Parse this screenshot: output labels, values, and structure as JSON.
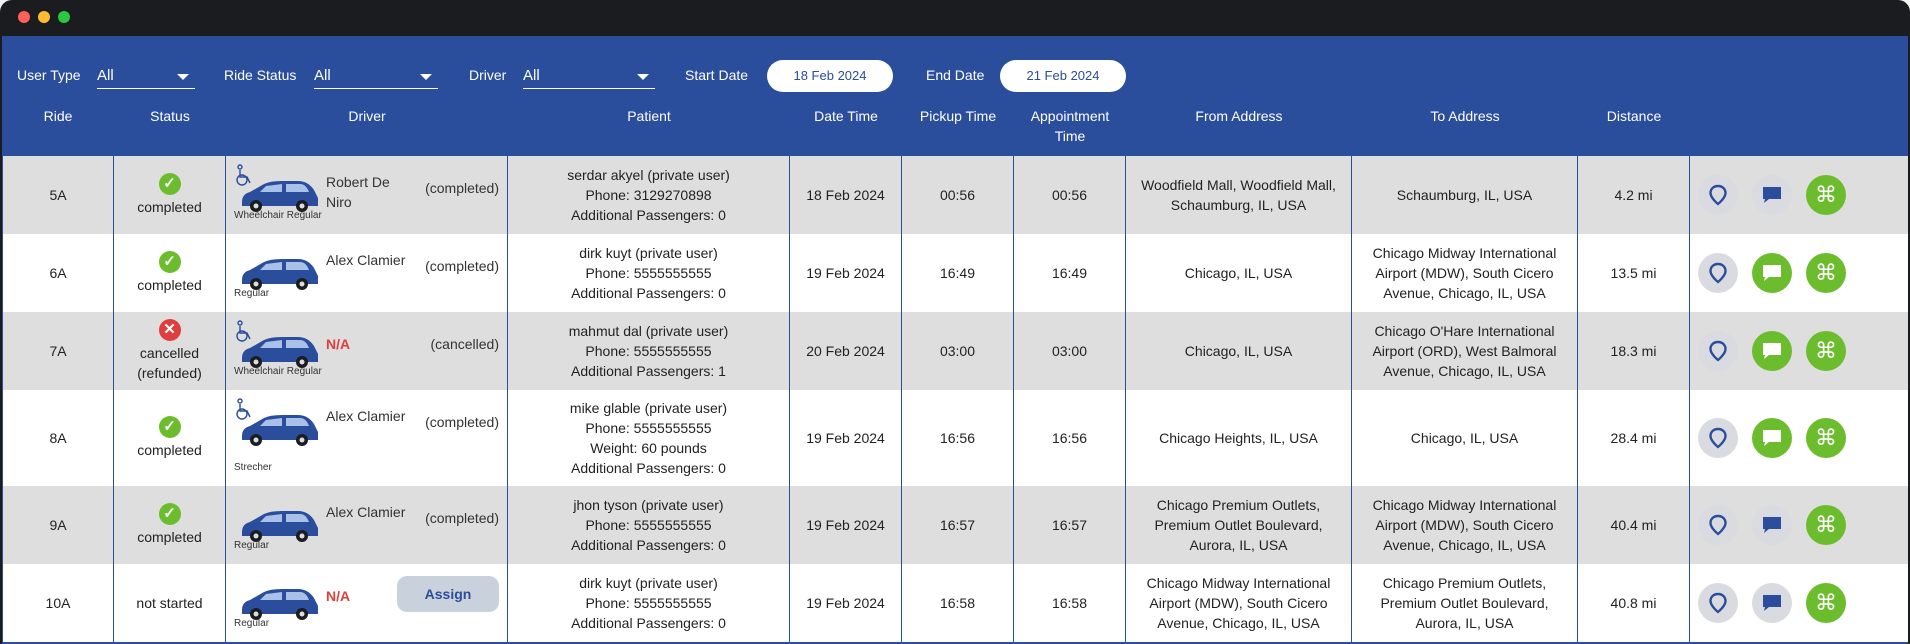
{
  "filters": {
    "user_type_label": "User Type",
    "user_type_value": "All",
    "ride_status_label": "Ride Status",
    "ride_status_value": "All",
    "driver_label": "Driver",
    "driver_value": "All",
    "start_date_label": "Start Date",
    "start_date_value": "18 Feb 2024",
    "end_date_label": "End Date",
    "end_date_value": "21 Feb 2024"
  },
  "columns": {
    "ride": "Ride",
    "status": "Status",
    "driver": "Driver",
    "patient": "Patient",
    "date_time": "Date Time",
    "pickup_time": "Pickup Time",
    "appointment_time_1": "Appointment",
    "appointment_time_2": "Time",
    "from_address": "From Address",
    "to_address": "To Address",
    "distance": "Distance"
  },
  "colors": {
    "header_bg": "#2a4d9c",
    "accent_green": "#6cbd2d",
    "error_red": "#e03e3e"
  },
  "rows": [
    {
      "ride": "5A",
      "status_line1": "completed",
      "status_line2": "",
      "status_icon": "check-icon",
      "vehicle_type": "Wheelchair Regular",
      "driver_name": "Robert De Niro",
      "driver_state": "(completed)",
      "patient_name": "serdar akyel (private user)",
      "patient_phone": "Phone: 3129270898",
      "patient_extra": "",
      "patient_passengers": "Additional Passengers: 0",
      "date_time": "18 Feb 2024",
      "pickup_time": "00:56",
      "appointment_time": "00:56",
      "from_address": "Woodfield Mall, Woodfield Mall, Schaumburg, IL, USA",
      "to_address": "Schaumburg, IL, USA",
      "distance": "4.2 mi"
    },
    {
      "ride": "6A",
      "status_line1": "completed",
      "status_line2": "",
      "status_icon": "check-icon",
      "vehicle_type": "Regular",
      "driver_name": "Alex Clamier",
      "driver_state": "(completed)",
      "patient_name": "dirk kuyt (private user)",
      "patient_phone": "Phone: 5555555555",
      "patient_extra": "",
      "patient_passengers": "Additional Passengers: 0",
      "date_time": "19 Feb 2024",
      "pickup_time": "16:49",
      "appointment_time": "16:49",
      "from_address": "Chicago, IL, USA",
      "to_address": "Chicago Midway International Airport (MDW), South Cicero Avenue, Chicago, IL, USA",
      "distance": "13.5 mi"
    },
    {
      "ride": "7A",
      "status_line1": "cancelled",
      "status_line2": "(refunded)",
      "status_icon": "x-icon",
      "vehicle_type": "Wheelchair Regular",
      "driver_name": "N/A",
      "driver_state": "(cancelled)",
      "patient_name": "mahmut dal (private user)",
      "patient_phone": "Phone: 5555555555",
      "patient_extra": "",
      "patient_passengers": "Additional Passengers: 1",
      "date_time": "20 Feb 2024",
      "pickup_time": "03:00",
      "appointment_time": "03:00",
      "from_address": "Chicago, IL, USA",
      "to_address": "Chicago O'Hare International Airport (ORD), West Balmoral Avenue, Chicago, IL, USA",
      "distance": "18.3 mi"
    },
    {
      "ride": "8A",
      "status_line1": "completed",
      "status_line2": "",
      "status_icon": "check-icon",
      "vehicle_type": "Strecher",
      "driver_name": "Alex Clamier",
      "driver_state": "(completed)",
      "patient_name": "mike glable (private user)",
      "patient_phone": "Phone: 5555555555",
      "patient_extra": "Weight: 60 pounds",
      "patient_passengers": "Additional Passengers: 0",
      "date_time": "19 Feb 2024",
      "pickup_time": "16:56",
      "appointment_time": "16:56",
      "from_address": "Chicago Heights, IL, USA",
      "to_address": "Chicago, IL, USA",
      "distance": "28.4 mi"
    },
    {
      "ride": "9A",
      "status_line1": "completed",
      "status_line2": "",
      "status_icon": "check-icon",
      "vehicle_type": "Regular",
      "driver_name": "Alex Clamier",
      "driver_state": "(completed)",
      "patient_name": "jhon tyson (private user)",
      "patient_phone": "Phone: 5555555555",
      "patient_extra": "",
      "patient_passengers": "Additional Passengers: 0",
      "date_time": "19 Feb 2024",
      "pickup_time": "16:57",
      "appointment_time": "16:57",
      "from_address": "Chicago Premium Outlets, Premium Outlet Boulevard, Aurora, IL, USA",
      "to_address": "Chicago Midway International Airport (MDW), South Cicero Avenue, Chicago, IL, USA",
      "distance": "40.4 mi"
    },
    {
      "ride": "10A",
      "status_line1": "not started",
      "status_line2": "",
      "status_icon": "",
      "vehicle_type": "Regular",
      "driver_name": "N/A",
      "driver_state": "",
      "assign_label": "Assign",
      "patient_name": "dirk kuyt (private user)",
      "patient_phone": "Phone: 5555555555",
      "patient_extra": "",
      "patient_passengers": "Additional Passengers: 0",
      "date_time": "19 Feb 2024",
      "pickup_time": "16:58",
      "appointment_time": "16:58",
      "from_address": "Chicago Midway International Airport (MDW), South Cicero Avenue, Chicago, IL, USA",
      "to_address": "Chicago Premium Outlets, Premium Outlet Boulevard, Aurora, IL, USA",
      "distance": "40.8 mi"
    }
  ]
}
